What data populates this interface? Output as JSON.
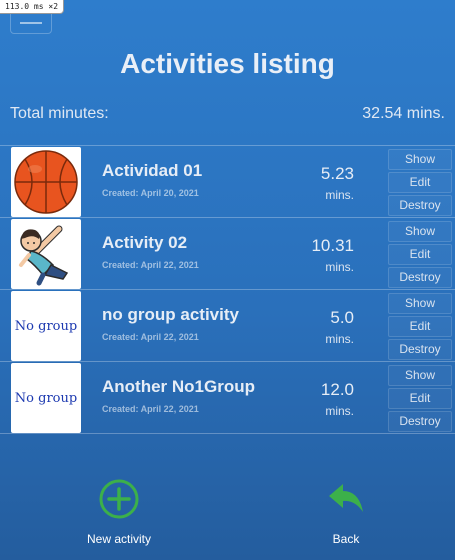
{
  "badge": "113.0",
  "badge_unit": "ms",
  "badge_scale": "×2",
  "page_title": "Activities listing",
  "total": {
    "label": "Total minutes:",
    "value": "32.54 mins."
  },
  "colors": {
    "accent_green": "#3cb04a",
    "background_top": "#2e7dcc",
    "background_bottom": "#245d9e"
  },
  "activities": [
    {
      "name": "Actividad 01",
      "created": "Created: April 20, 2021",
      "minutes": "5.23",
      "unit": "mins.",
      "image": "basketball-icon",
      "image_text": "",
      "buttons": {
        "show": "Show",
        "edit": "Edit",
        "destroy": "Destroy"
      }
    },
    {
      "name": "Activity 02",
      "created": "Created: April 22, 2021",
      "minutes": "10.31",
      "unit": "mins.",
      "image": "stretching-person-icon",
      "image_text": "",
      "buttons": {
        "show": "Show",
        "edit": "Edit",
        "destroy": "Destroy"
      }
    },
    {
      "name": "no group activity",
      "created": "Created: April 22, 2021",
      "minutes": "5.0",
      "unit": "mins.",
      "image": "no-group-placeholder",
      "image_text": "No group",
      "buttons": {
        "show": "Show",
        "edit": "Edit",
        "destroy": "Destroy"
      }
    },
    {
      "name": "Another No1Group",
      "created": "Created: April 22, 2021",
      "minutes": "12.0",
      "unit": "mins.",
      "image": "no-group-placeholder",
      "image_text": "No group",
      "buttons": {
        "show": "Show",
        "edit": "Edit",
        "destroy": "Destroy"
      }
    }
  ],
  "footer": {
    "new_activity": {
      "label": "New activity",
      "icon": "plus-circle-icon"
    },
    "back": {
      "label": "Back",
      "icon": "back-arrow-icon"
    }
  }
}
